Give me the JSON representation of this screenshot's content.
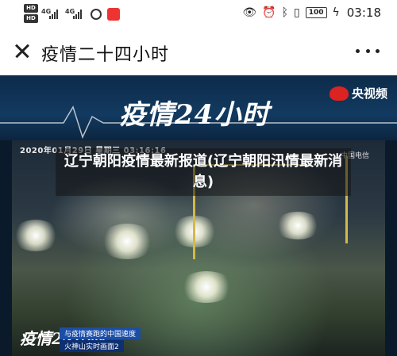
{
  "statusbar": {
    "sim1": "HD",
    "sim2": "HD",
    "network1": "4G",
    "network2": "4G",
    "battery": "100",
    "time": "03:18"
  },
  "header": {
    "title": "疫情二十四小时"
  },
  "article": {
    "banner_title": "疫情24小时",
    "broadcaster": "央视频",
    "timestamp": "2020年01月29日 星期三 03:16:16",
    "telecom": "中国电信",
    "headline": "辽宁朝阳疫情最新报道(辽宁朝阳汛情最新消息)",
    "lower_third_brand": "疫情24小时",
    "lower_third_line1": "与疫情赛跑的中国速度",
    "lower_third_line2": "火神山实时画面2"
  }
}
